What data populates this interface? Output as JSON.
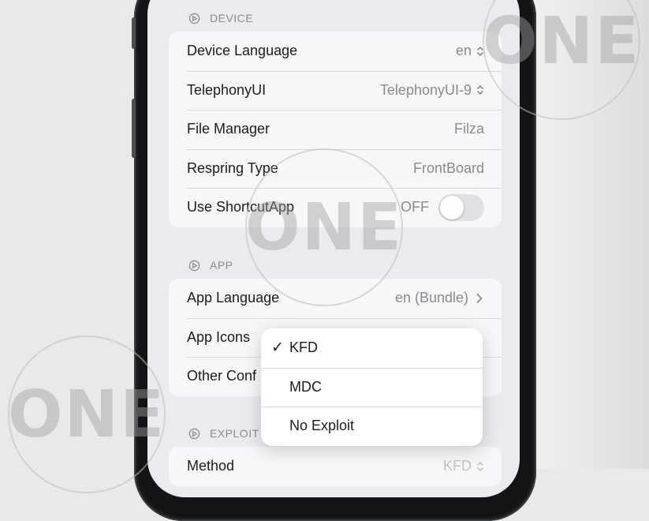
{
  "sections": {
    "device": {
      "header": "DEVICE",
      "rows": [
        {
          "label": "Device Language",
          "value": "en"
        },
        {
          "label": "TelephonyUI",
          "value": "TelephonyUI-9"
        },
        {
          "label": "File Manager",
          "value": "Filza"
        },
        {
          "label": "Respring Type",
          "value": "FrontBoard"
        },
        {
          "label": "Use ShortcutApp",
          "value": "OFF",
          "toggle_on": false
        }
      ]
    },
    "app": {
      "header": "APP",
      "rows": [
        {
          "label": "App Language",
          "value": "en (Bundle)"
        },
        {
          "label": "App Icons"
        },
        {
          "label": "Other Conf"
        }
      ]
    },
    "exploit": {
      "header": "EXPLOIT",
      "rows": [
        {
          "label": "Method",
          "value": "KFD"
        }
      ]
    }
  },
  "exploit_menu": {
    "items": [
      {
        "label": "KFD",
        "checked": true
      },
      {
        "label": "MDC",
        "checked": false
      },
      {
        "label": "No Exploit",
        "checked": false
      }
    ],
    "check_glyph": "✓"
  },
  "watermark": {
    "text": "ONE"
  },
  "colors": {
    "background": "#e9e9e9",
    "screen": "#eceaef",
    "cell": "#f7f7f9",
    "secondary_text": "#8a8a8e"
  }
}
